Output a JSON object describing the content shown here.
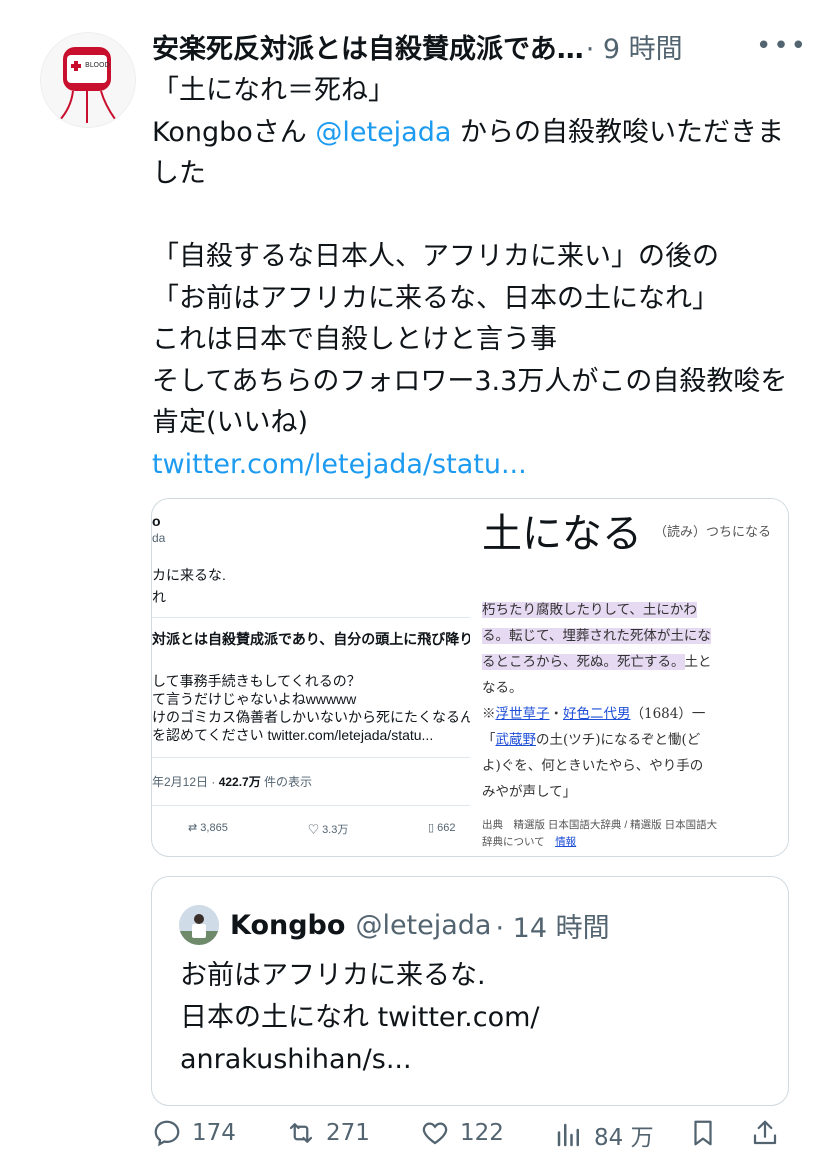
{
  "tweet": {
    "display_name": "安楽死反対派とは自殺賛成派であ…",
    "time": "· 9 時間",
    "more_icon": "more-dots-icon",
    "lines": [
      "「土になれ＝死ね」",
      "Kongboさん ",
      "@letejada",
      " からの自殺教唆いただきました",
      "",
      "「自殺するな日本人、アフリカに来い」の後の",
      "「お前はアフリカに来るな、日本の土になれ」",
      "これは日本で自殺しとけと言う事",
      "そしてあちらのフォロワー3.3万人がこの自殺教唆を肯定(いいね)"
    ],
    "link": "twitter.com/letejada/statu..."
  },
  "media_left": {
    "frag1": "o",
    "frag2": "da",
    "frag3": "カに来るな.",
    "frag4": "れ",
    "frag5": "対派とは自殺賛成派であり、自分の頭上に飛び降り避",
    "frag6": "して事務手続きもしてくれるの？",
    "frag7": "て言うだけじゃないよねwwwww",
    "frag8": "けのゴミカス偽善者しかいないから死にたくなるん",
    "frag9": "を認めてください twitter.com/letejada/statu...",
    "frag10": "年2月12日 · ",
    "views": "422.7万",
    "views_suffix": " 件の表示",
    "rt": "3,865",
    "likes": "3.3万",
    "bm": "662"
  },
  "media_right": {
    "heading": "土になる",
    "reading": "（読み）つちになる",
    "p1": "朽ちたり腐敗したりして、土にかわ",
    "p2": "る。転じて、埋葬された死体が土にな",
    "p3": "るところから、死ぬ。死亡する。",
    "p3b": "土と",
    "p4": "なる。",
    "p5a": "※",
    "p5b": "浮世草子",
    "p5c": "・",
    "p5d": "好色二代男",
    "p5e": "（1684）一",
    "p6a": "「",
    "p6b": "武蔵野",
    "p6c": "の土(ツチ)になるぞと慟(ど",
    "p7": "よ)ぐを、何ときいたやら、やり手の",
    "p8": "みやが声して」",
    "src1": "出典　精選版 日本国語大辞典 / 精選版 日本国語大",
    "src2": "辞典について",
    "src_link": "情報"
  },
  "quote": {
    "name": "Kongbo",
    "handle": "@letejada",
    "time": "· 14 時間",
    "lines": [
      "お前はアフリカに来るな.",
      "日本の土になれ twitter.com/",
      "anrakushihan/s..."
    ]
  },
  "actions": {
    "replies": "174",
    "retweets": "271",
    "likes": "122",
    "views": "84 万"
  },
  "colors": {
    "link": "#1d9bf0",
    "muted": "#536471",
    "highlight": "#e6d9f2"
  }
}
